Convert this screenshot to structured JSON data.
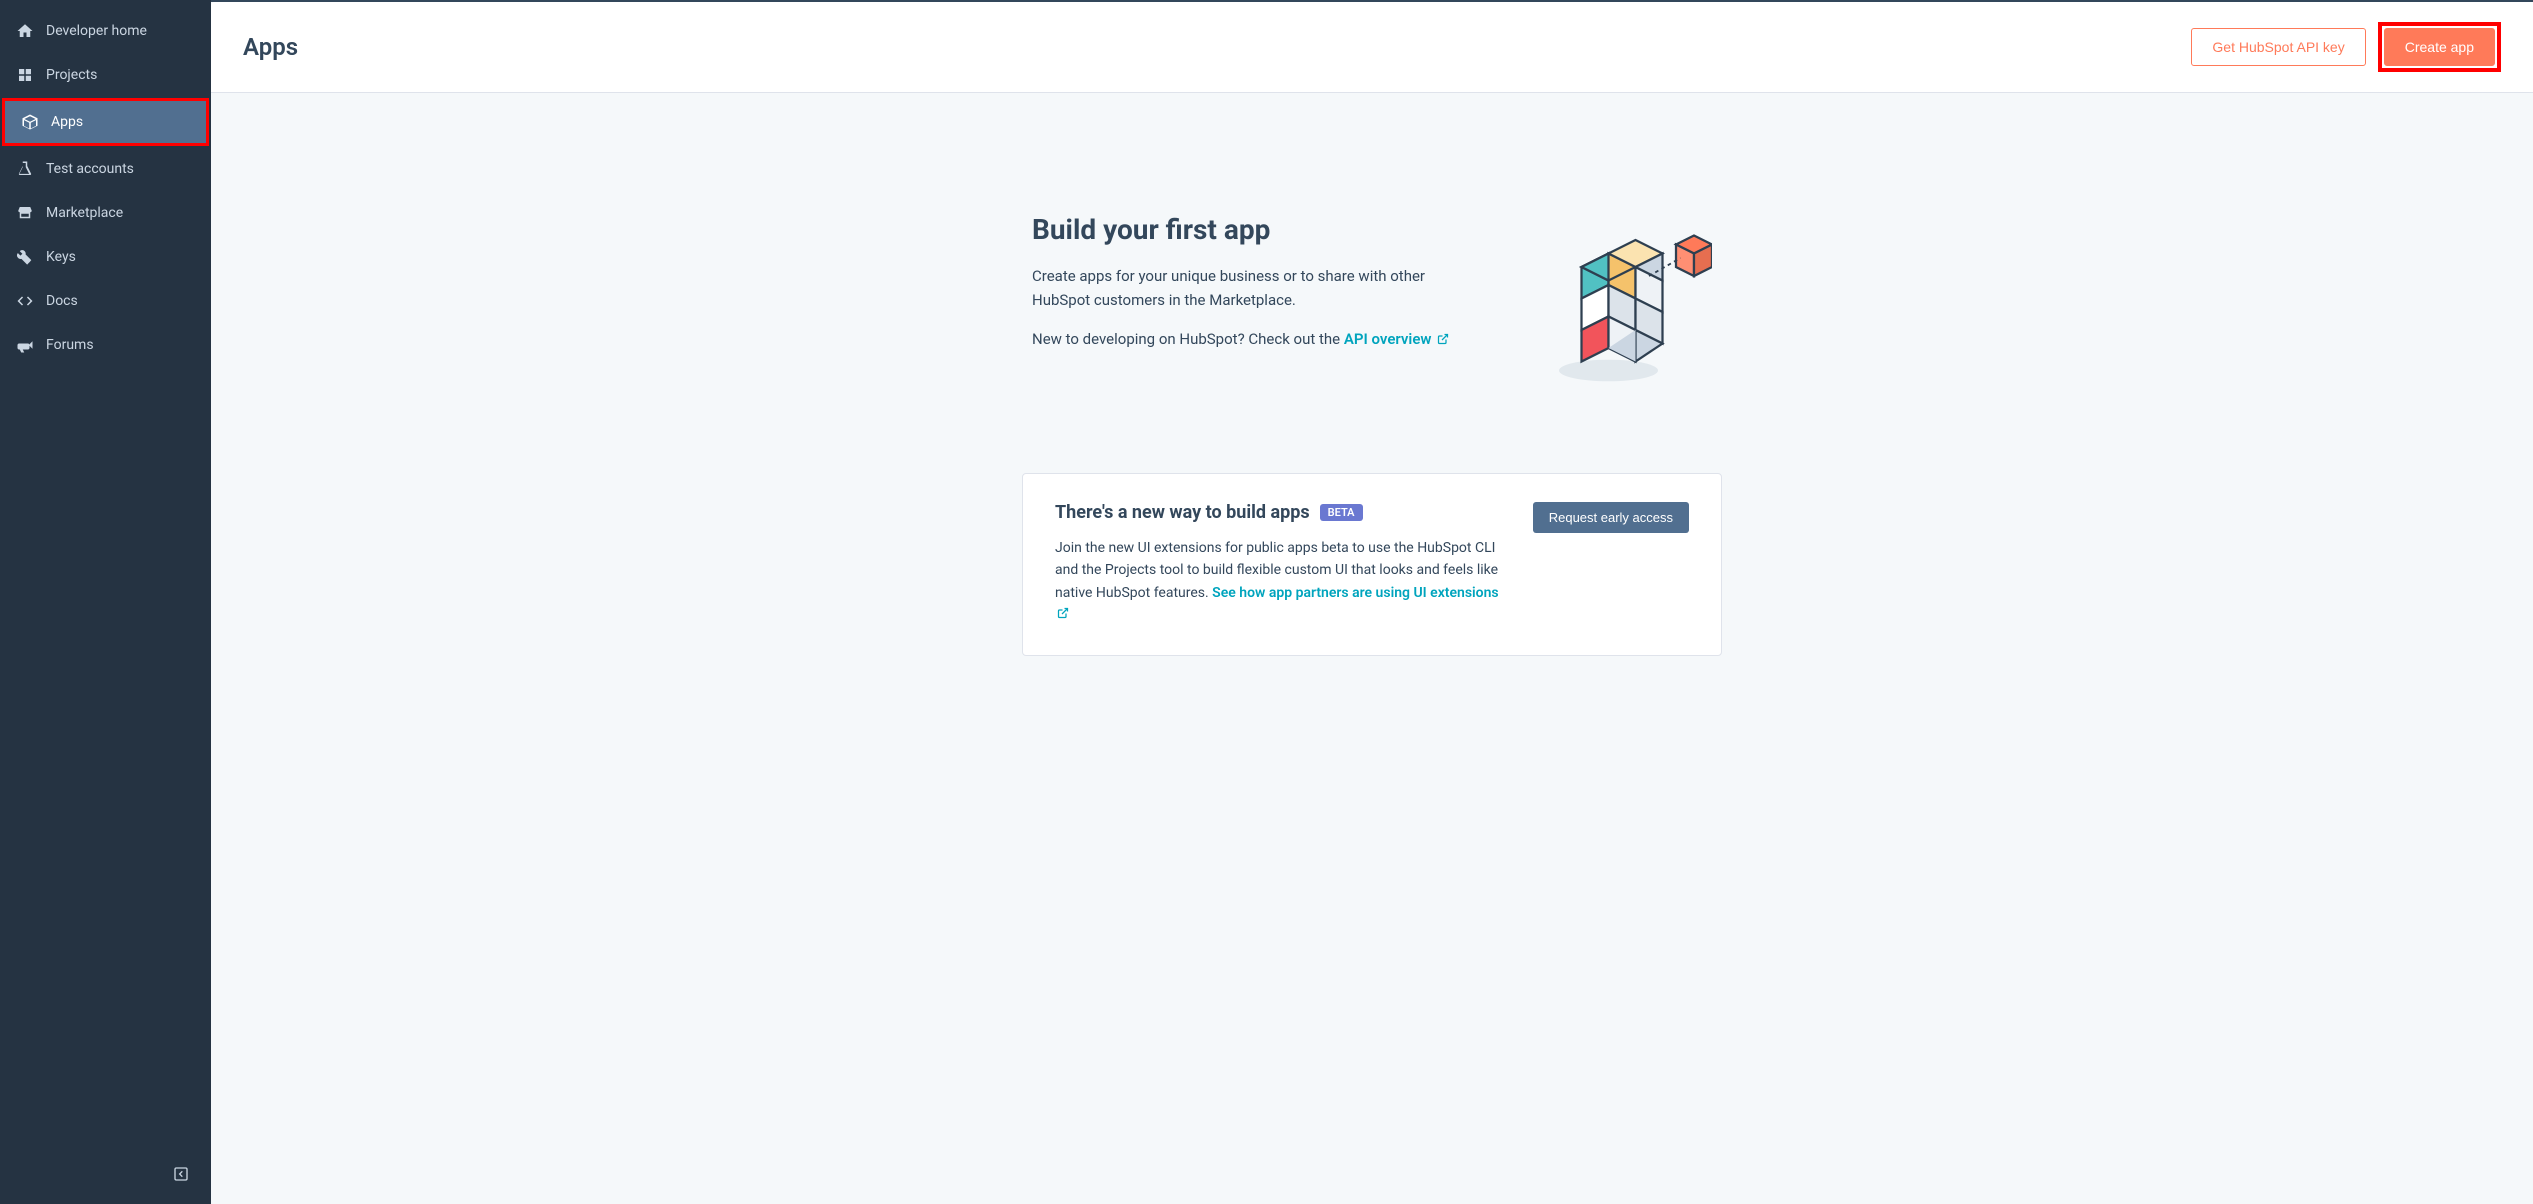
{
  "sidebar": {
    "items": [
      {
        "label": "Developer home",
        "icon": "home-icon"
      },
      {
        "label": "Projects",
        "icon": "grid-icon"
      },
      {
        "label": "Apps",
        "icon": "cube-icon",
        "active": true
      },
      {
        "label": "Test accounts",
        "icon": "flask-icon"
      },
      {
        "label": "Marketplace",
        "icon": "store-icon"
      },
      {
        "label": "Keys",
        "icon": "wrench-icon"
      },
      {
        "label": "Docs",
        "icon": "code-icon"
      },
      {
        "label": "Forums",
        "icon": "megaphone-icon"
      }
    ]
  },
  "header": {
    "title": "Apps",
    "api_key_button": "Get HubSpot API key",
    "create_button": "Create app"
  },
  "hero": {
    "title": "Build your first app",
    "description": "Create apps for your unique business or to share with other HubSpot customers in the Marketplace.",
    "cta_prefix": "New to developing on HubSpot? Check out the ",
    "cta_link": "API overview"
  },
  "card": {
    "title": "There's a new way to build apps",
    "badge": "BETA",
    "text_prefix": "Join the new UI extensions for public apps beta to use the HubSpot CLI and the Projects tool to build flexible custom UI that looks and feels like native HubSpot features. ",
    "link_text": "See how app partners are using UI extensions",
    "button": "Request early access"
  }
}
